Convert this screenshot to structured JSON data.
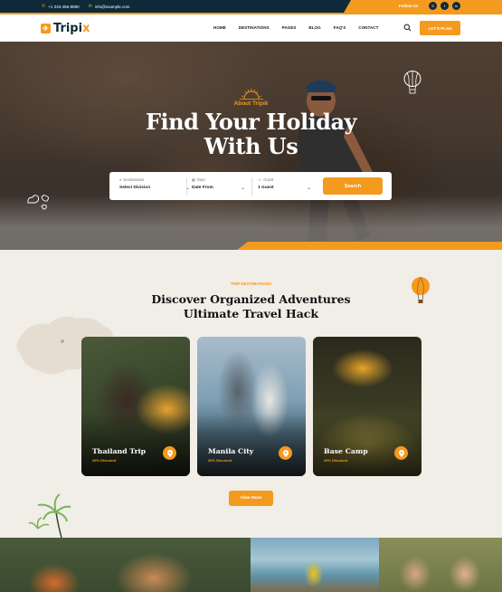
{
  "topbar": {
    "phone": "+1 333-456-8890",
    "email": "info@example.com",
    "follow_label": "Follow Us",
    "socials": [
      {
        "icon": "x-icon",
        "glyph": "𝕏"
      },
      {
        "icon": "facebook-icon",
        "glyph": "f"
      },
      {
        "icon": "linkedin-icon",
        "glyph": "in"
      }
    ]
  },
  "nav": {
    "logo_main": "Tripi",
    "logo_accent": "x",
    "items": [
      "HOME",
      "DESTINATIONS",
      "PAGES",
      "BLOG",
      "FAQ'S",
      "CONTACT"
    ],
    "cta": "LET'S PLAN"
  },
  "hero": {
    "kicker": "About Tripik",
    "title_line1": "Find Your Holiday",
    "title_line2": "With Us",
    "search": {
      "destinations_label": "Destinations",
      "destinations_value": "Select Division",
      "date_label": "Date",
      "date_value": "Date From",
      "guest_label": "Guest",
      "guest_value": "1 Guest",
      "button": "Search"
    }
  },
  "destinations": {
    "eyebrow": "TRIP DESTINATIONS",
    "title_line1": "Discover Organized Adventures",
    "title_line2": "Ultimate Travel Hack",
    "cards": [
      {
        "name": "Thailand Trip",
        "discount": "20% Discount"
      },
      {
        "name": "Manila City",
        "discount": "20% Discount"
      },
      {
        "name": "Base Camp",
        "discount": "20% Discount"
      }
    ],
    "view_more": "View More"
  },
  "colors": {
    "accent": "#f39a1f",
    "dark": "#0e2a38"
  }
}
